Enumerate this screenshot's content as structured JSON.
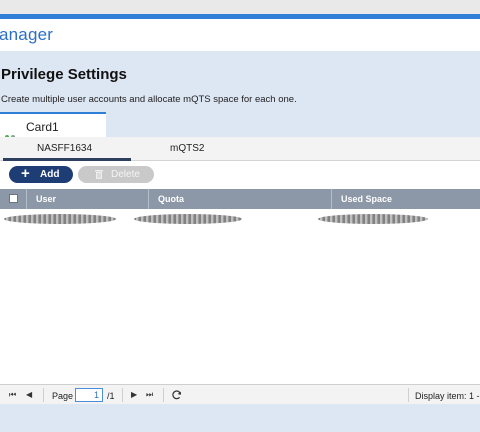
{
  "app": {
    "title": "anager"
  },
  "section": {
    "title": "Privilege Settings",
    "description": "Create multiple user accounts and allocate mQTS space for each one."
  },
  "card_tab": {
    "label": "Card1"
  },
  "subtabs": [
    {
      "label": "NASFF1634",
      "active": true
    },
    {
      "label": "mQTS2",
      "active": false
    }
  ],
  "toolbar": {
    "add_label": "Add",
    "add_icon": "plus-icon",
    "delete_label": "Delete",
    "delete_icon": "trash-icon"
  },
  "table": {
    "columns": [
      "User",
      "Quota",
      "Used Space"
    ],
    "rows_redacted": 1
  },
  "pager": {
    "page_label": "Page",
    "page_value": "1",
    "page_total": "/1",
    "display_item": "Display item: 1 -"
  },
  "colors": {
    "accent": "#2f7ed8",
    "add_button": "#1f3d75",
    "grid_header": "#8c98a8",
    "background": "#dde6f3"
  }
}
